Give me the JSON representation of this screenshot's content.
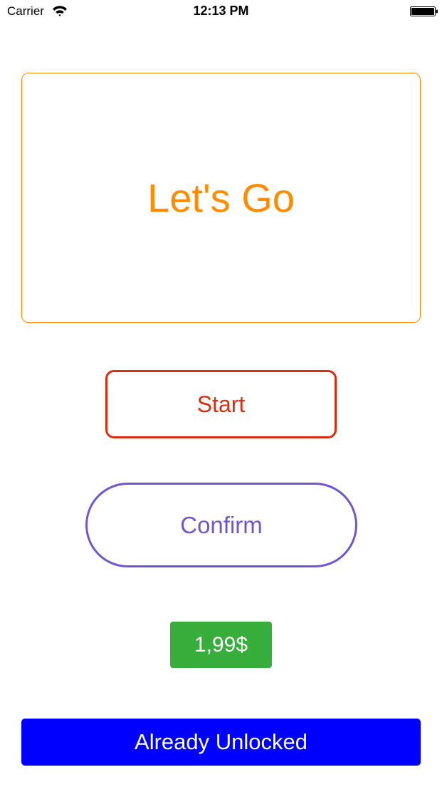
{
  "status_bar": {
    "carrier": "Carrier",
    "time": "12:13 PM",
    "wifi_icon": "wifi-icon",
    "battery_icon": "battery-full-icon"
  },
  "buttons": {
    "lets_go": "Let's Go",
    "start": "Start",
    "confirm": "Confirm",
    "price": "1,99$",
    "already_unlocked": "Already Unlocked"
  },
  "colors": {
    "lets_go": "#FF8C00",
    "start": "#D8300F",
    "confirm": "#7356CF",
    "price_bg": "#37AD3B",
    "unlocked_bg": "#0000FF"
  }
}
